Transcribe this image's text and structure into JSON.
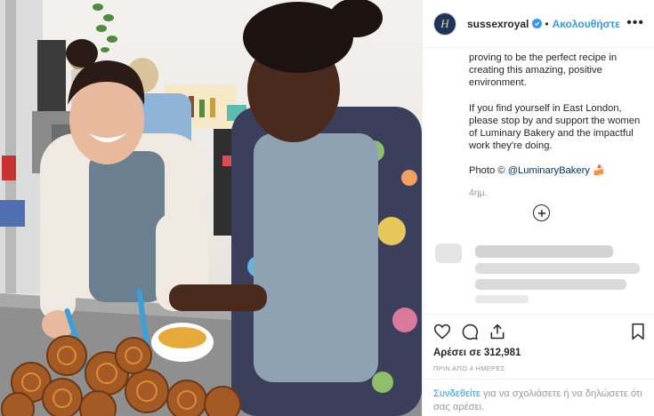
{
  "header": {
    "avatar_glyph": "H",
    "username": "sussexroyal",
    "separator": "•",
    "follow_label": "Ακολουθήστε",
    "more_label": "•••"
  },
  "caption": {
    "para1": "proving to be the perfect recipe in creating this amazing, positive environment.",
    "para2": "If you find yourself in East London, please stop by and support the women of Luminary Bakery and the impactful work they're doing.",
    "photo_prefix": "Photo © ",
    "photo_mention": "@LuminaryBakery",
    "photo_emoji": "🍰",
    "time": "4ημ."
  },
  "stats": {
    "likes": "Αρέσει σε 312,981",
    "date": "ΠΡΙΝ ΑΠΟ 4 ΗΜΕΡΕΣ"
  },
  "login": {
    "link": "Συνδεθείτε",
    "rest": " για να σχολιάσετε ή να δηλώσετε ότι σας αρέσει."
  },
  "icons": {
    "like": "heart-icon",
    "comment": "comment-icon",
    "share": "share-icon",
    "save": "bookmark-icon",
    "load_more": "plus-circle-icon"
  },
  "colors": {
    "link_blue": "#3897f0",
    "verified": "#3897f0",
    "mention": "#003569",
    "muted": "#999999",
    "border": "#efefef"
  }
}
